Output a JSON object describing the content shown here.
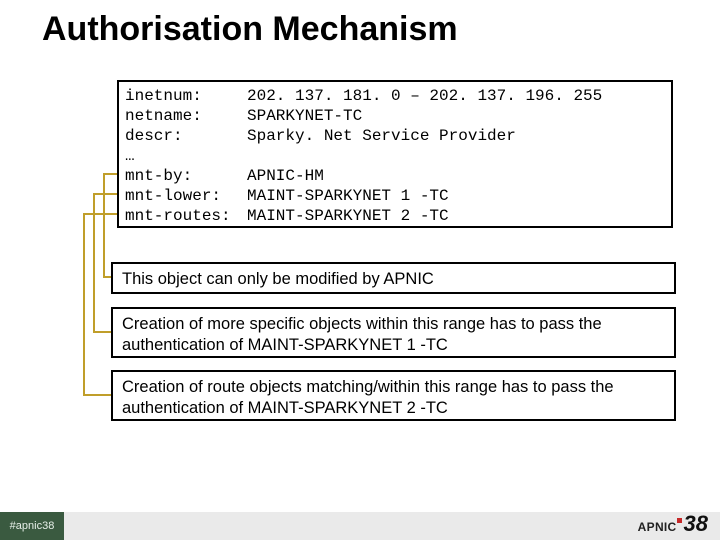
{
  "title": "Authorisation Mechanism",
  "record": {
    "inetnum": {
      "key": "inetnum:",
      "value": "202. 137. 181. 0 – 202. 137. 196. 255"
    },
    "netname": {
      "key": "netname:",
      "value": "SPARKYNET-TC"
    },
    "descr": {
      "key": "descr:",
      "value": "Sparky. Net Service Provider"
    },
    "ellipsis": {
      "key": "…",
      "value": ""
    },
    "mnt_by": {
      "key": "mnt-by:",
      "value": "APNIC-HM"
    },
    "mnt_lower": {
      "key": "mnt-lower:",
      "value": "MAINT-SPARKYNET 1 -TC"
    },
    "mnt_routes": {
      "key": "mnt-routes:",
      "value": "MAINT-SPARKYNET 2 -TC"
    }
  },
  "explain": {
    "e1": "This object can only be modified by APNIC",
    "e2": "Creation of more specific objects within this range has to pass the authentication of MAINT-SPARKYNET 1 -TC",
    "e3": "Creation of route objects matching/within this range has  to pass the authentication of MAINT-SPARKYNET 2 -TC"
  },
  "footer": {
    "hashtag": "#apnic38",
    "logo_text": "APNIC",
    "logo_num": "38"
  }
}
